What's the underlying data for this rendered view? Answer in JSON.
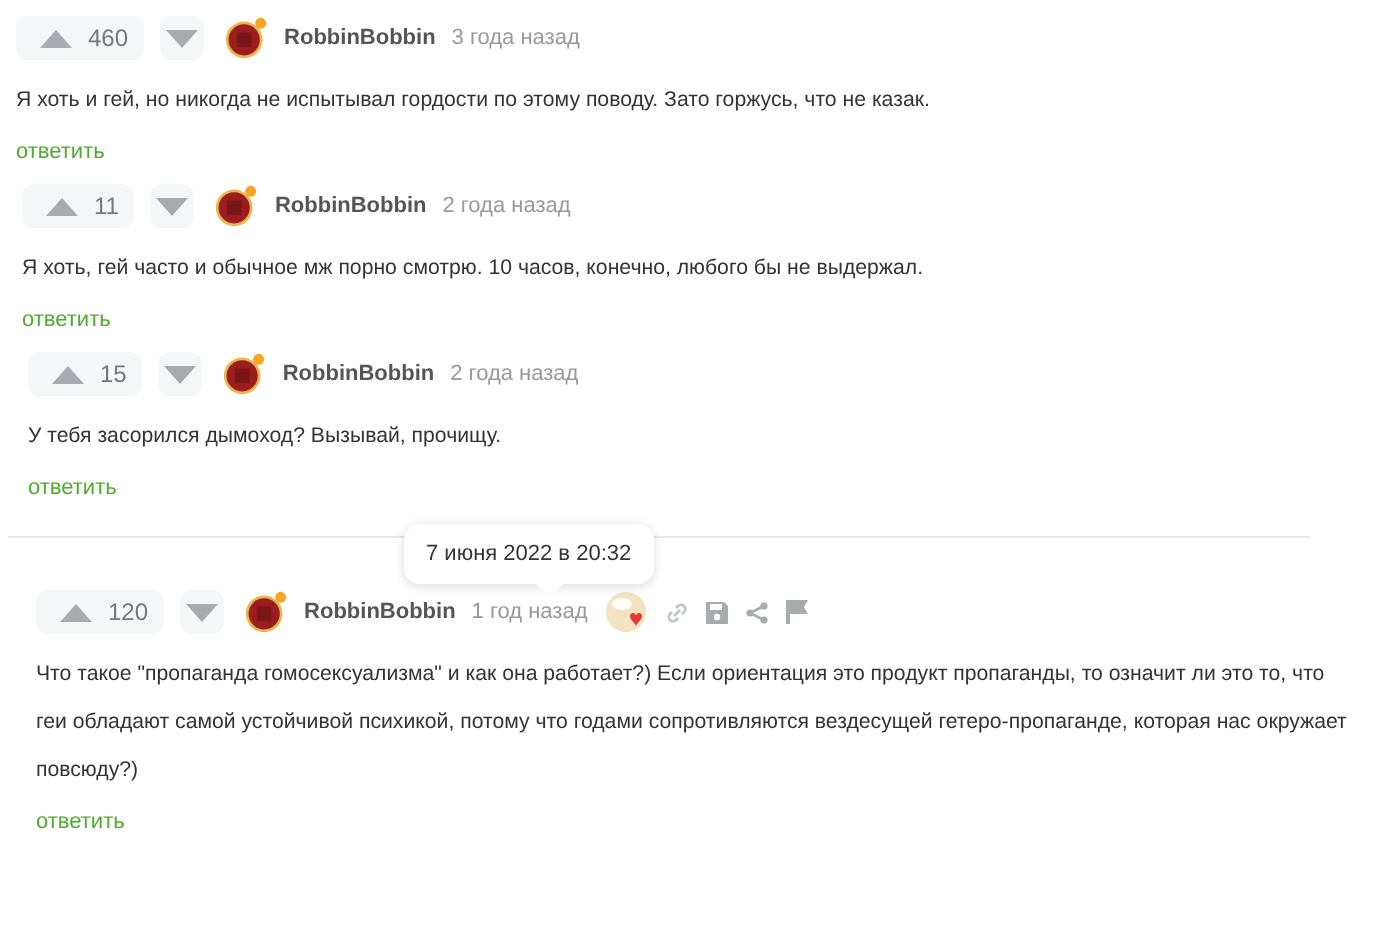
{
  "threads": [
    {
      "rating": "460",
      "author": "RobbinBobbin",
      "time": "3 года назад",
      "text": "Я хоть и гей, но никогда не испытывал гордости по этому поводу. Зато горжусь, что не казак.",
      "reply": "ответить",
      "tools": false,
      "children": [
        {
          "rating": "11",
          "author": "RobbinBobbin",
          "time": "2 года назад",
          "text": "Я хоть, гей часто и обычное мж порно смотрю. 10 часов, конечно, любого бы не выдержал.",
          "reply": "ответить",
          "tools": false,
          "children": [
            {
              "rating": "15",
              "author": "RobbinBobbin",
              "time": "2 года назад",
              "text": "У тебя засорился дымоход? Вызывай, прочищу.",
              "reply": "ответить",
              "tools": false
            }
          ]
        }
      ]
    },
    {
      "rating": "120",
      "author": "RobbinBobbin",
      "time": "1 год назад",
      "text": "Что такое \"пропаганда гомосексуализма\" и как она работает?) Если ориентация это продукт пропаганды, то означит ли это то, что геи обладают самой устойчивой психикой, потому что годами сопротивляются вездесущей гетеро-пропаганде, которая нас окружает повсюду?)",
      "reply": "ответить",
      "tools": true,
      "tooltip": "7 июня 2022 в 20:32"
    }
  ]
}
